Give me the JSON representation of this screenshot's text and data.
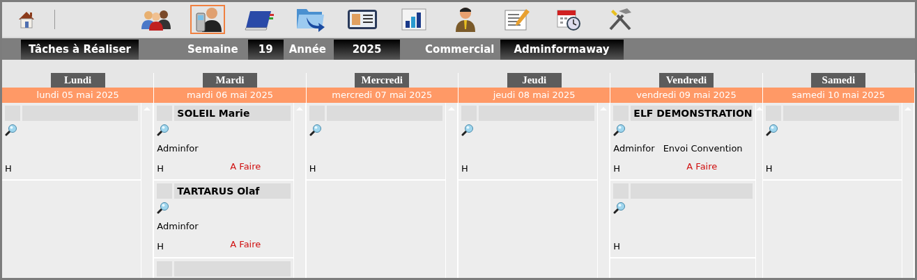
{
  "toolbar": {
    "home": {
      "kind": "home"
    },
    "tools": [
      {
        "kind": "people",
        "selected": false
      },
      {
        "kind": "phone",
        "selected": true
      },
      {
        "kind": "book",
        "selected": false
      },
      {
        "kind": "folder",
        "selected": false
      },
      {
        "kind": "card",
        "selected": false
      },
      {
        "kind": "chart",
        "selected": false
      },
      {
        "kind": "person",
        "selected": false
      },
      {
        "kind": "document",
        "selected": false
      },
      {
        "kind": "calendar",
        "selected": false
      },
      {
        "kind": "tools",
        "selected": false
      }
    ]
  },
  "filter_bar": {
    "title": "Tâches à Réaliser",
    "week_label": "Semaine",
    "week": "19",
    "year_label": "Année",
    "year": "2025",
    "salesperson_label": "Commercial",
    "salesperson": "Adminformaway"
  },
  "days": [
    {
      "label": "Lundi",
      "date": "lundi 05 mai 2025",
      "tasks": [
        {
          "kind": "task",
          "hour": "H"
        }
      ]
    },
    {
      "label": "Mardi",
      "date": "mardi 06 mai 2025",
      "tasks": [
        {
          "kind": "task",
          "name": "SOLEIL Marie",
          "user": "Adminfor",
          "hour": "H",
          "status": "A Faire"
        },
        {
          "kind": "task",
          "name": "TARTARUS Olaf",
          "user": "Adminfor",
          "hour": "H",
          "status": "A Faire"
        },
        {
          "kind": "task"
        }
      ]
    },
    {
      "label": "Mercredi",
      "date": "mercredi 07 mai 2025",
      "tasks": [
        {
          "kind": "task",
          "hour": "H"
        }
      ]
    },
    {
      "label": "Jeudi",
      "date": "jeudi 08 mai 2025",
      "tasks": [
        {
          "kind": "task",
          "hour": "H"
        }
      ]
    },
    {
      "label": "Vendredi",
      "date": "vendredi 09 mai 2025",
      "tasks": [
        {
          "kind": "task",
          "name": "ELF DEMONSTRATION",
          "user": "Adminfor",
          "subject": "Envoi Convention",
          "hour": "H",
          "status": "A Faire"
        },
        {
          "kind": "task",
          "hour": "H"
        }
      ]
    },
    {
      "label": "Samedi",
      "date": "samedi 10 mai 2025",
      "tasks": [
        {
          "kind": "task",
          "hour": "H"
        }
      ]
    }
  ]
}
